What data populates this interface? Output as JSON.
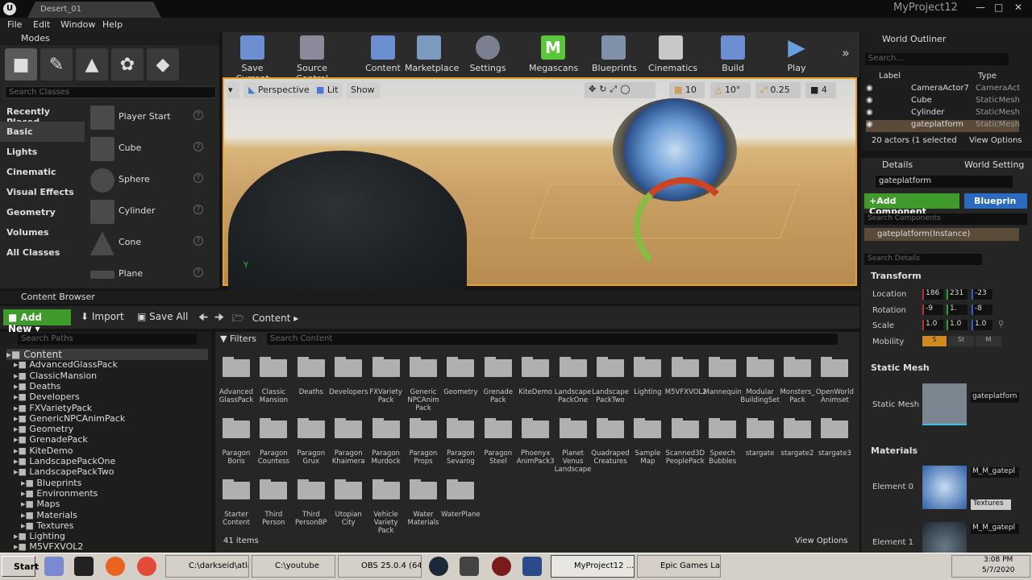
{
  "window": {
    "tab": "Desert_01",
    "project": "MyProject12"
  },
  "menu": [
    "File",
    "Edit",
    "Window",
    "Help"
  ],
  "modes": {
    "title": "Modes",
    "search_placeholder": "Search Classes",
    "categories": [
      "Recently Placed",
      "Basic",
      "Lights",
      "Cinematic",
      "Visual Effects",
      "Geometry",
      "Volumes",
      "All Classes"
    ],
    "classes": [
      "Player Start",
      "Cube",
      "Sphere",
      "Cylinder",
      "Cone",
      "Plane"
    ]
  },
  "toolbar": [
    "Save Current",
    "Source Control",
    "Content",
    "Marketplace",
    "Settings",
    "Megascans",
    "Blueprints",
    "Cinematics",
    "Build",
    "Play"
  ],
  "viewport": {
    "perspective": "Perspective",
    "lit": "Lit",
    "show": "Show",
    "grid": "10",
    "angle": "10°",
    "scale": "0.25",
    "camspeed": "4",
    "axis": "Y"
  },
  "outliner": {
    "title": "World Outliner",
    "search": "Search...",
    "col_label": "Label",
    "col_type": "Type",
    "rows": [
      {
        "label": "CameraActor7",
        "type": "CameraAct"
      },
      {
        "label": "Cube",
        "type": "StaticMesh"
      },
      {
        "label": "Cylinder",
        "type": "StaticMesh"
      },
      {
        "label": "gateplatform",
        "type": "StaticMesh"
      }
    ],
    "status": "20 actors (1 selected",
    "view_options": "View Options"
  },
  "details": {
    "tab1": "Details",
    "tab2": "World Setting",
    "name": "gateplatform",
    "add_component": "+Add Component",
    "blueprint": "Blueprin",
    "search_components": "Search Components",
    "instance": "gateplatform(Instance)",
    "search_details": "Search Details",
    "transform": "Transform",
    "location": "Location",
    "rotation": "Rotation",
    "scale": "Scale",
    "mobility": "Mobility",
    "loc": [
      "186",
      "231",
      "-23"
    ],
    "rot": [
      "-9",
      "1.",
      "-8"
    ],
    "scl": [
      "1.0",
      "1.0",
      "1.0"
    ],
    "mob": [
      "S",
      "St",
      "M"
    ],
    "static_mesh_hdr": "Static Mesh",
    "static_mesh": "Static Mesh",
    "mesh_value": "gateplatforn",
    "materials_hdr": "Materials",
    "element0": "Element 0",
    "element1": "Element 1",
    "mat0": "M_M_gatepl",
    "mat1": "M_M_gatepl",
    "textures": "Textures"
  },
  "content_browser": {
    "title": "Content Browser",
    "add_new": "Add New",
    "import": "Import",
    "save_all": "Save All",
    "path": "Content",
    "search_paths": "Search Paths",
    "filters": "Filters",
    "search_content": "Search Content",
    "count": "41 items",
    "view_options": "View Options",
    "tree": [
      "Content",
      "AdvancedGlassPack",
      "ClassicMansion",
      "Deaths",
      "Developers",
      "FXVarietyPack",
      "GenericNPCAnimPack",
      "Geometry",
      "GrenadePack",
      "KiteDemo",
      "LandscapePackOne",
      "LandscapePackTwo",
      "Blueprints",
      "Environments",
      "Maps",
      "Materials",
      "Textures",
      "Lighting",
      "M5VFXVOL2"
    ],
    "folders": [
      "Advanced GlassPack",
      "Classic Mansion",
      "Deaths",
      "Developers",
      "FXVariety Pack",
      "Generic NPCAnim Pack",
      "Geometry",
      "Grenade Pack",
      "KiteDemo",
      "Landscape PackOne",
      "Landscape PackTwo",
      "Lighting",
      "M5VFXVOL2",
      "Mannequin",
      "Modular BuildingSet",
      "Monsters_ Pack",
      "OpenWorld Animset",
      "Paragon Boris",
      "Paragon Countess",
      "Paragon Grux",
      "Paragon Khaimera",
      "Paragon Murdock",
      "Paragon Props",
      "Paragon Sevarog",
      "Paragon Steel",
      "Phoenyx AnimPack3",
      "Planet Venus Landscape",
      "Quadraped Creatures",
      "Sample Map",
      "Scanned3D PeoplePack",
      "Speech Bubbles",
      "stargate",
      "stargate2",
      "stargate3",
      "Starter Content",
      "Third Person",
      "Third PersonBP",
      "Utopian City",
      "Vehicle Variety Pack",
      "Water Materials",
      "WaterPlane"
    ]
  },
  "taskbar": {
    "start": "Start",
    "tasks": [
      "C:\\darkseid\\atla...",
      "C:\\youtube",
      "OBS 25.0.4 (64...",
      "MyProject12 ...",
      "Epic Games Lau..."
    ],
    "time": "3:08 PM",
    "date": "5/7/2020"
  }
}
